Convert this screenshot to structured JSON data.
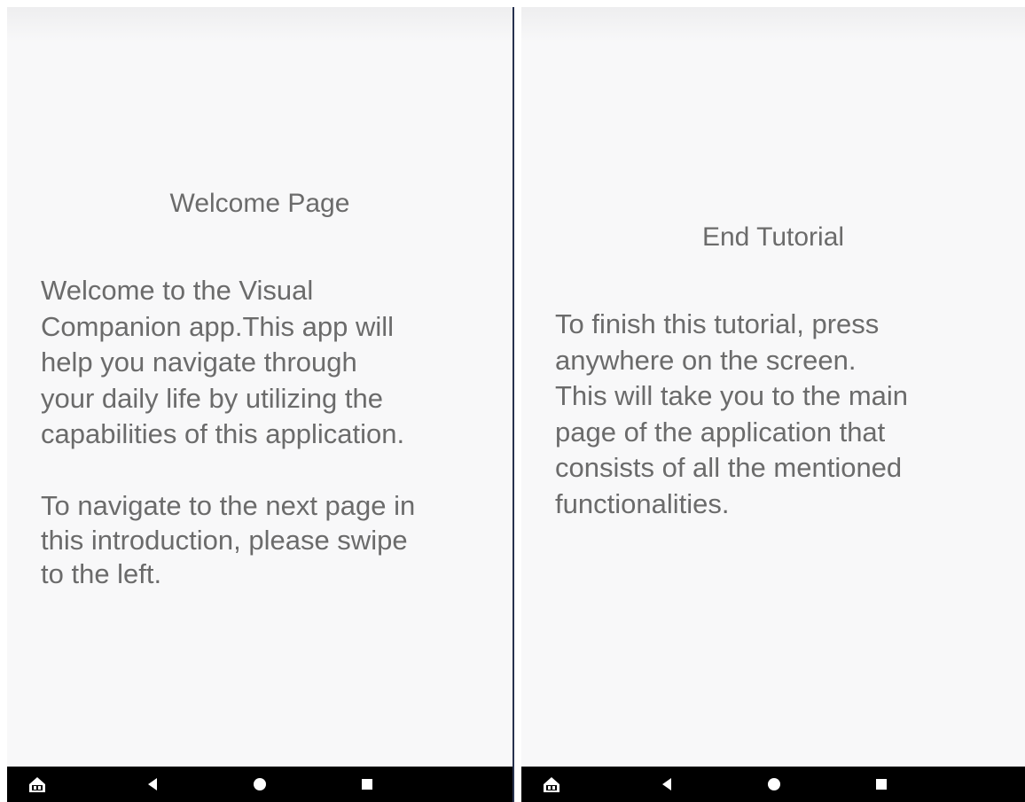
{
  "left_page": {
    "title": "Welcome Page",
    "paragraph_1": "Welcome to the Visual\nCompanion app.This app will\nhelp you navigate through\nyour daily life by utilizing the\ncapabilities of this application.",
    "paragraph_2": "To navigate to the next page in\nthis introduction, please swipe\nto the left."
  },
  "right_page": {
    "title": "End Tutorial",
    "paragraph": "To finish this tutorial, press\nanywhere on the screen.\nThis will take you to the main\npage of the application that\nconsists of all the mentioned\nfunctionalities."
  },
  "navbar": {
    "icons": [
      "accessibility-home-icon",
      "back-triangle-icon",
      "home-circle-icon",
      "recents-square-icon"
    ]
  },
  "colors": {
    "screen_background": "#f8f8f9",
    "text": "#6b6b6b",
    "navbar": "#000000",
    "divider": "#27324f"
  }
}
